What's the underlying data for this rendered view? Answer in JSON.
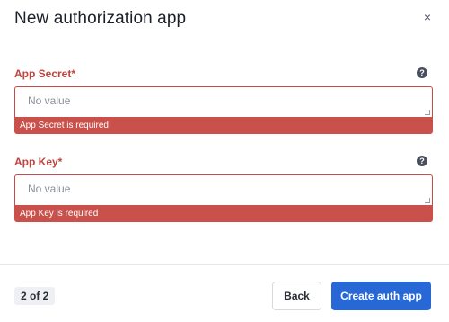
{
  "dialog": {
    "title": "New authorization app",
    "close_symbol": "×"
  },
  "fields": [
    {
      "label": "App Secret*",
      "placeholder": "No value",
      "value": "",
      "error": "App Secret is required",
      "help_icon": "question-circle-icon"
    },
    {
      "label": "App Key*",
      "placeholder": "No value",
      "value": "",
      "error": "App Key is required",
      "help_icon": "question-circle-icon"
    }
  ],
  "footer": {
    "step": "2 of 2",
    "back_label": "Back",
    "create_label": "Create auth app"
  },
  "colors": {
    "error": "#c9504b",
    "primary": "#2767d6"
  }
}
